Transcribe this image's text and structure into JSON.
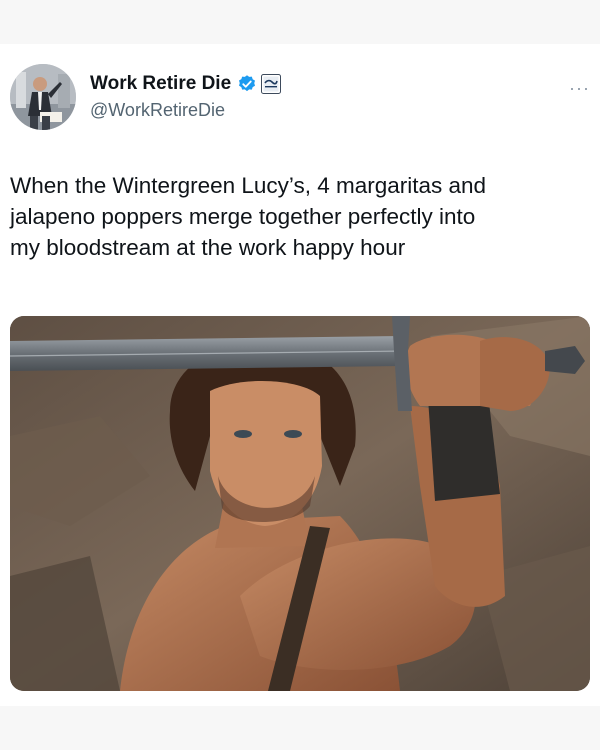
{
  "tweet": {
    "author": {
      "display_name": "Work Retire Die",
      "handle": "@WorkRetireDie",
      "verified": true,
      "avatar_icon": "avatar-photo",
      "affiliation_icon": "affiliate-badge-icon"
    },
    "more_label": "···",
    "text": "When the Wintergreen Lucy’s, 4 margaritas and\njalapeno poppers merge together perfectly into\nmy bloodstream at the work happy hour",
    "media": {
      "icon": "warrior-with-sword-photo"
    }
  },
  "colors": {
    "verified_blue": "#1d9bf0",
    "text_primary": "#0f1419",
    "text_secondary": "#536471",
    "page_bg": "#f7f7f7",
    "card_bg": "#ffffff"
  }
}
